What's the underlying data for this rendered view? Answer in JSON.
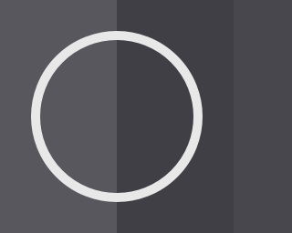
{
  "icon": {
    "name": "circle-outline-icon",
    "colors": {
      "left_panel": "#58575d",
      "right_panel": "#403f45",
      "ring": "#e8e8e8"
    }
  }
}
